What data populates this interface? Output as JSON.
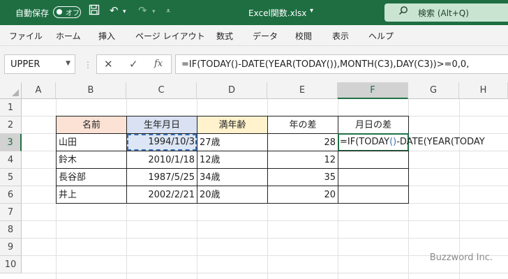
{
  "titlebar": {
    "autosave_label": "自動保存",
    "autosave_state": "オフ",
    "doc_title": "Excel関数.xlsx",
    "search_label": "検索 (Alt+Q)",
    "icons": [
      "save-icon",
      "undo-icon",
      "redo-icon",
      "customize-icon",
      "search-icon"
    ]
  },
  "menu": [
    "ファイル",
    "ホーム",
    "挿入",
    "ページ レイアウト",
    "数式",
    "データ",
    "校閲",
    "表示",
    "ヘルプ"
  ],
  "formula_bar": {
    "name_box": "UPPER",
    "fx_label": "fx",
    "formula": "=IF(TODAY()-DATE(YEAR(TODAY()),MONTH(C3),DAY(C3))>=0,0,"
  },
  "columns": [
    "A",
    "B",
    "C",
    "D",
    "E",
    "F",
    "G",
    "H"
  ],
  "rows": [
    "1",
    "2",
    "3",
    "4",
    "5",
    "6",
    "7",
    "8",
    "9",
    "10"
  ],
  "table": {
    "headers": [
      "名前",
      "生年月日",
      "満年齢",
      "年の差",
      "月日の差"
    ],
    "rows": [
      [
        "山田",
        "1994/10/3",
        "27歳",
        "28"
      ],
      [
        "鈴木",
        "2010/1/18",
        "12歳",
        "12"
      ],
      [
        "長谷部",
        "1987/5/25",
        "34歳",
        "35"
      ],
      [
        "井上",
        "2002/2/21",
        "20歳",
        "20"
      ]
    ]
  },
  "editing_cell": {
    "part1": "=IF(TODAY",
    "part2": "()",
    "part3": "-DATE(YEAR(TODAY"
  },
  "watermark": "Buzzword Inc.",
  "colors": {
    "titlebar_bg": "#1e6e42",
    "header_name_bg": "#fbe2d5",
    "header_birth_bg": "#d9e1f2",
    "header_age_bg": "#fff2cc"
  }
}
